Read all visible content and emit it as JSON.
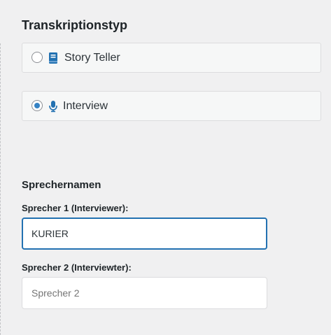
{
  "transcription": {
    "title": "Transkriptionstyp",
    "options": [
      {
        "label": "Story Teller",
        "icon": "book-icon",
        "checked": false
      },
      {
        "label": "Interview",
        "icon": "microphone-icon",
        "checked": true
      }
    ]
  },
  "speakers": {
    "title": "Sprechernamen",
    "speaker1": {
      "label": "Sprecher 1 (Interviewer):",
      "value": "KURIER",
      "placeholder": ""
    },
    "speaker2": {
      "label": "Sprecher 2 (Interviewter):",
      "value": "",
      "placeholder": "Sprecher 2"
    }
  },
  "colors": {
    "accent": "#2271b1",
    "radio_checked": "#3582c4",
    "icon": "#2271b1"
  }
}
